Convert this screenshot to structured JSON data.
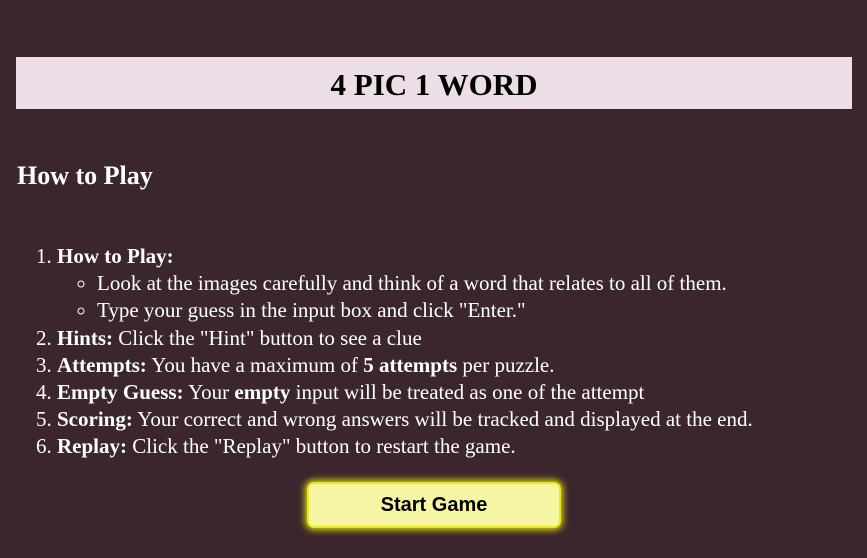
{
  "header": {
    "title": "4 PIC 1 WORD"
  },
  "instructions": {
    "heading": "How to Play",
    "items": [
      {
        "label": "How to Play:",
        "subitems": [
          "Look at the images carefully and think of a word that relates to all of them.",
          "Type your guess in the input box and click \"Enter.\""
        ]
      },
      {
        "label": "Hints:",
        "text": " Click the \"Hint\" button to see a clue"
      },
      {
        "label": "Attempts:",
        "text_before": " You have a maximum of ",
        "bold": "5 attempts",
        "text_after": " per puzzle."
      },
      {
        "label": "Empty Guess:",
        "text_before": " Your ",
        "bold": "empty",
        "text_after": " input will be treated as one of the attempt"
      },
      {
        "label": "Scoring:",
        "text": " Your correct and wrong answers will be tracked and displayed at the end."
      },
      {
        "label": "Replay:",
        "text": " Click the \"Replay\" button to restart the game."
      }
    ]
  },
  "start_button": {
    "label": "Start Game"
  },
  "colors": {
    "background": "#3b262e",
    "title_bar": "#ebdee6",
    "button_fill": "#f5f5a3",
    "button_border": "#e9e91f"
  }
}
